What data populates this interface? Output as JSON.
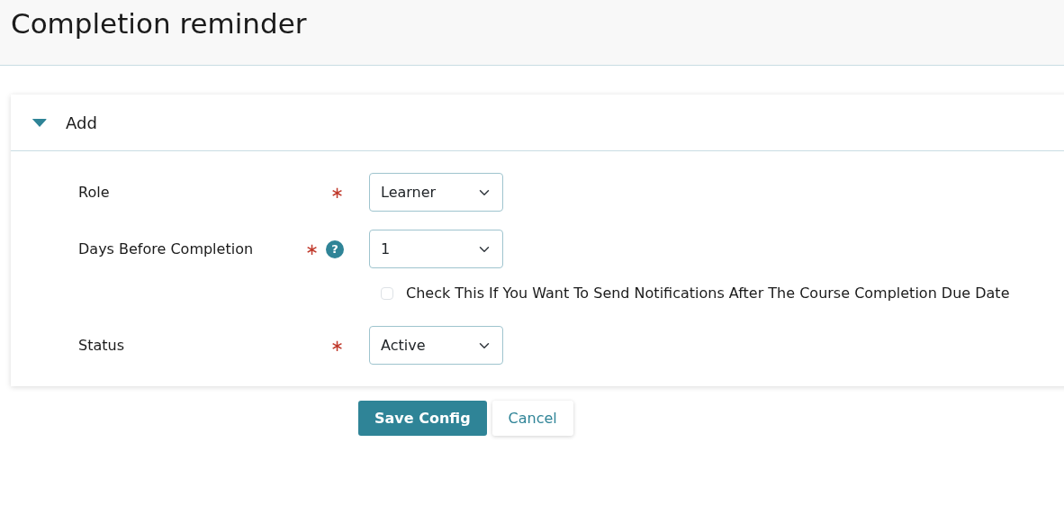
{
  "page": {
    "title": "Completion reminder"
  },
  "panel": {
    "title": "Add",
    "expanded": true
  },
  "fields": [
    {
      "kind": "select",
      "label": "Role",
      "required": "∗",
      "value": "Learner"
    },
    {
      "kind": "select",
      "label": "Days Before Completion",
      "required": "∗",
      "help": "?",
      "value": "1"
    },
    {
      "kind": "checkbox",
      "label": "Check This If You Want To Send Notifications After The Course Completion Due Date",
      "checked": false
    },
    {
      "kind": "select",
      "label": "Status",
      "required": "∗",
      "value": "Active"
    }
  ],
  "buttons": [
    {
      "label": "Save Config",
      "kind": "primary"
    },
    {
      "label": "Cancel",
      "kind": "secondary"
    }
  ]
}
